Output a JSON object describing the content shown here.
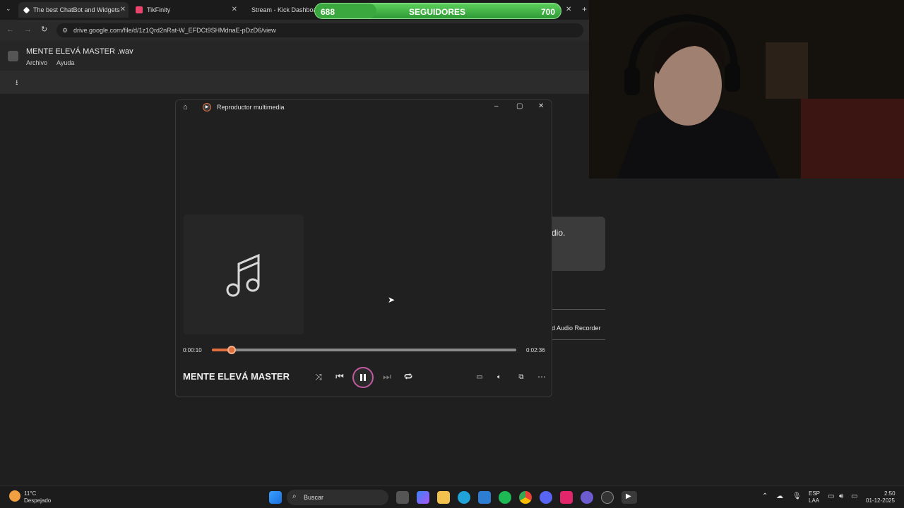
{
  "browser": {
    "tabs": [
      {
        "title": "The best ChatBot and Widgets",
        "color": "#ffffff"
      },
      {
        "title": "TikFinity",
        "color": "#e8446c"
      },
      {
        "title": "Stream - Kick Dashboa",
        "color": "#53fc18"
      }
    ],
    "url": "drive.google.com/file/d/1z1Qrd2nRat-W_EFDCt9SHMdnaE-pDzD6/view"
  },
  "drive": {
    "file_title": "MENTE ELEVÁ MASTER .wav",
    "menu": [
      "Archivo",
      "Ayuda"
    ]
  },
  "follower_bar": {
    "current": "688",
    "label": "SEGUIDORES",
    "goal": "700",
    "progress": 0.25
  },
  "player": {
    "window_title": "Reproductor multimedia",
    "track_title": "MENTE ELEVÁ MASTER",
    "elapsed": "0:00:10",
    "duration": "0:02:36",
    "progress": 0.064
  },
  "background_panel": {
    "dialog_text": "dio.",
    "recorder_text": "d Audio Recorder"
  },
  "taskbar": {
    "weather_temp": "11°C",
    "weather_desc": "Despejado",
    "search_placeholder": "Buscar",
    "lang_top": "ESP",
    "lang_bottom": "LAA",
    "time": "2:50",
    "date": "01-12-2025"
  },
  "colors": {
    "accent": "#e07040",
    "follower_green": "#4cbf4c"
  }
}
